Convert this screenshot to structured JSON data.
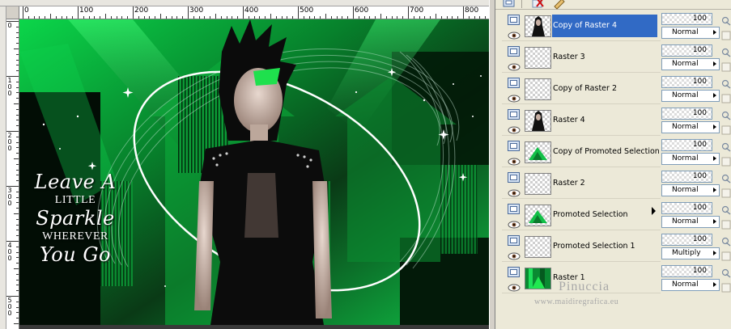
{
  "rulers": {
    "horizontal_labels": [
      "0",
      "100",
      "200",
      "300",
      "400",
      "500",
      "600",
      "700",
      "800"
    ],
    "vertical_labels": [
      "0",
      "100",
      "200",
      "300",
      "400",
      "500"
    ]
  },
  "canvas": {
    "quote_lines": [
      "Leave A",
      "LITTLE",
      "Sparkle",
      "WHEREVER",
      "You Go"
    ]
  },
  "layers_panel": {
    "layers": [
      {
        "name": "Copy of Raster 4",
        "selected": true,
        "thumb": "woman-figure",
        "opacity": "100",
        "blend": "Normal"
      },
      {
        "name": "Raster 3",
        "selected": false,
        "thumb": "transparent",
        "opacity": "100",
        "blend": "Normal"
      },
      {
        "name": "Copy of Raster 2",
        "selected": false,
        "thumb": "transparent",
        "opacity": "100",
        "blend": "Normal"
      },
      {
        "name": "Raster 4",
        "selected": false,
        "thumb": "woman-figure",
        "opacity": "100",
        "blend": "Normal"
      },
      {
        "name": "Copy of Promoted Selection",
        "selected": false,
        "thumb": "green-shape",
        "opacity": "100",
        "blend": "Normal"
      },
      {
        "name": "Raster 2",
        "selected": false,
        "thumb": "transparent",
        "opacity": "100",
        "blend": "Normal"
      },
      {
        "name": "Promoted Selection",
        "selected": false,
        "thumb": "green-shape",
        "opacity": "100",
        "blend": "Normal"
      },
      {
        "name": "Promoted Selection 1",
        "selected": false,
        "thumb": "transparent",
        "opacity": "100",
        "blend": "Multiply"
      },
      {
        "name": "Raster 1",
        "selected": false,
        "thumb": "green-fill",
        "opacity": "100",
        "blend": "Normal"
      }
    ]
  },
  "watermark": {
    "name": "Pinuccia",
    "url": "www.maidiregrafica.eu"
  },
  "colors": {
    "selection": "#316ac5",
    "panel_bg": "#ece9d8",
    "art_green": "#1edc4a"
  }
}
